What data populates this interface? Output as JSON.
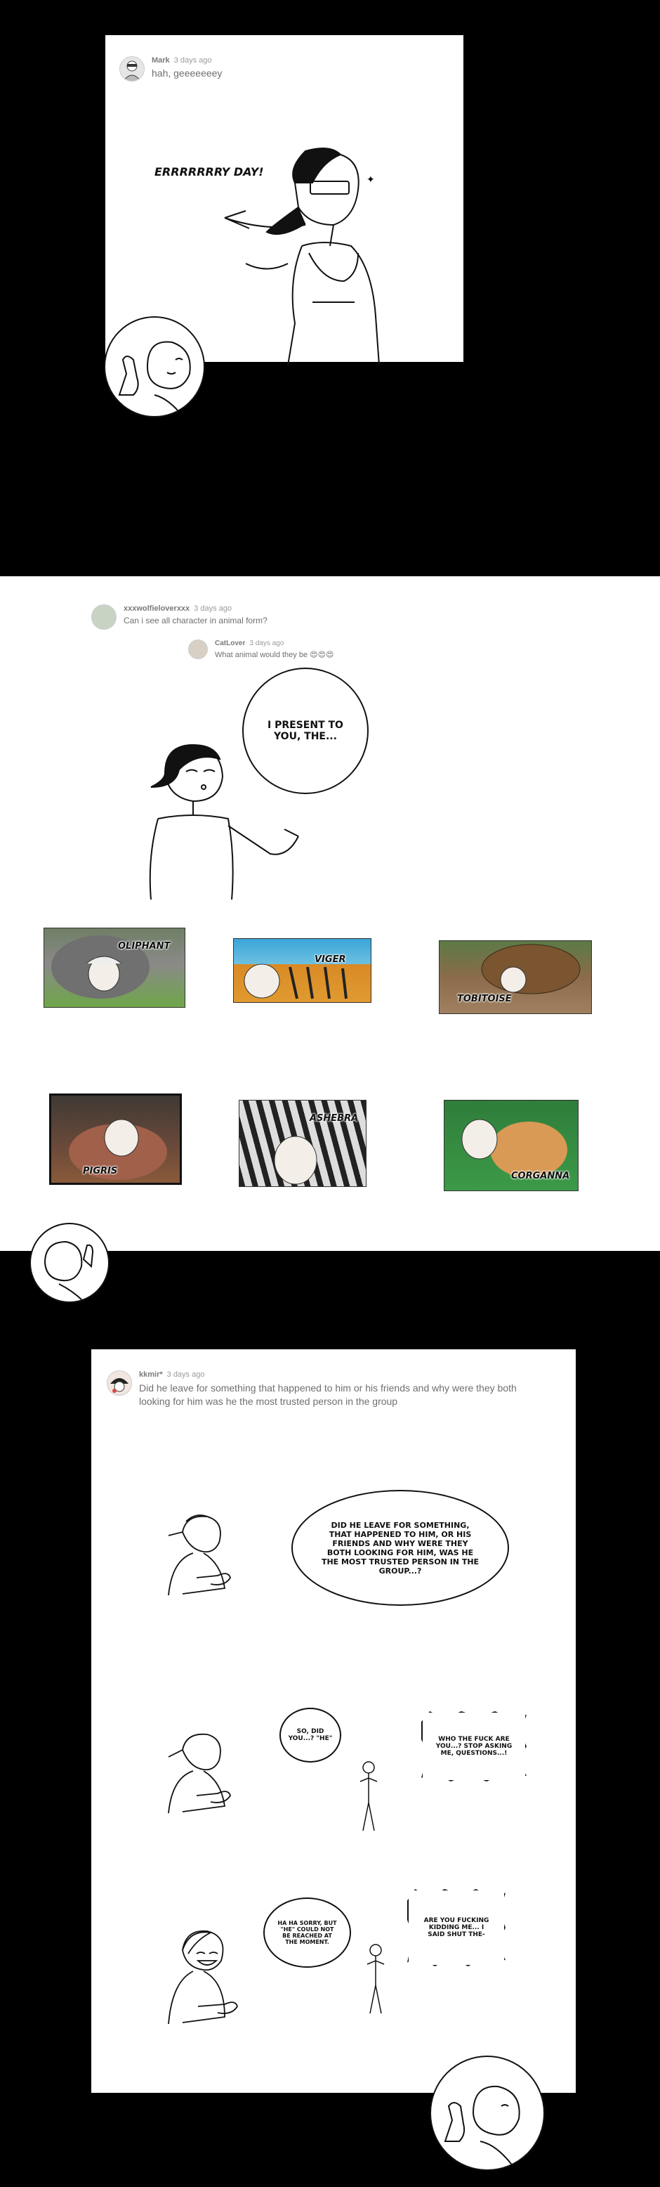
{
  "section1": {
    "comment": {
      "user": "Mark",
      "time": "3 days ago",
      "text": "hah, geeeeeeey"
    },
    "shout": "ERRRRRRRY DAY!"
  },
  "section2": {
    "comment": {
      "user": "xxxwolfieloverxxx",
      "time": "3 days ago",
      "text": "Can i see all character in animal form?"
    },
    "reply": {
      "user": "CatLover",
      "time": "3 days ago",
      "text": "What animal would they be 😍😍😍"
    },
    "bubble": "I PRESENT TO YOU, THE...",
    "animals": [
      {
        "label": "OLIPHANT"
      },
      {
        "label": "VIGER"
      },
      {
        "label": "TOBITOISE"
      },
      {
        "label": "PIGRIS"
      },
      {
        "label": "ASHEBRA"
      },
      {
        "label": "CORGANNA"
      }
    ]
  },
  "section3": {
    "comment": {
      "user": "kkmir*",
      "time": "3 days ago",
      "text": "Did he leave for something that happened to him or his friends and why were they both looking for him was he the most trusted person in the group"
    },
    "bubble1": "DID HE LEAVE FOR SOMETHING, THAT HAPPENED TO HIM, OR HIS FRIENDS AND WHY WERE THEY BOTH LOOKING FOR HIM, WAS HE THE MOST TRUSTED PERSON IN THE GROUP...?",
    "bubble2": "SO, DID YOU...? \"HE\"",
    "bubble3": "WHO THE FUCK ARE YOU...? STOP ASKING ME, QUESTIONS...!",
    "bubble4": "HA HA SORRY, BUT \"HE\" COULD NOT BE REACHED AT THE MOMENT.",
    "bubble5": "ARE YOU FUCKING KIDDING ME... I SAID SHUT THE-"
  }
}
